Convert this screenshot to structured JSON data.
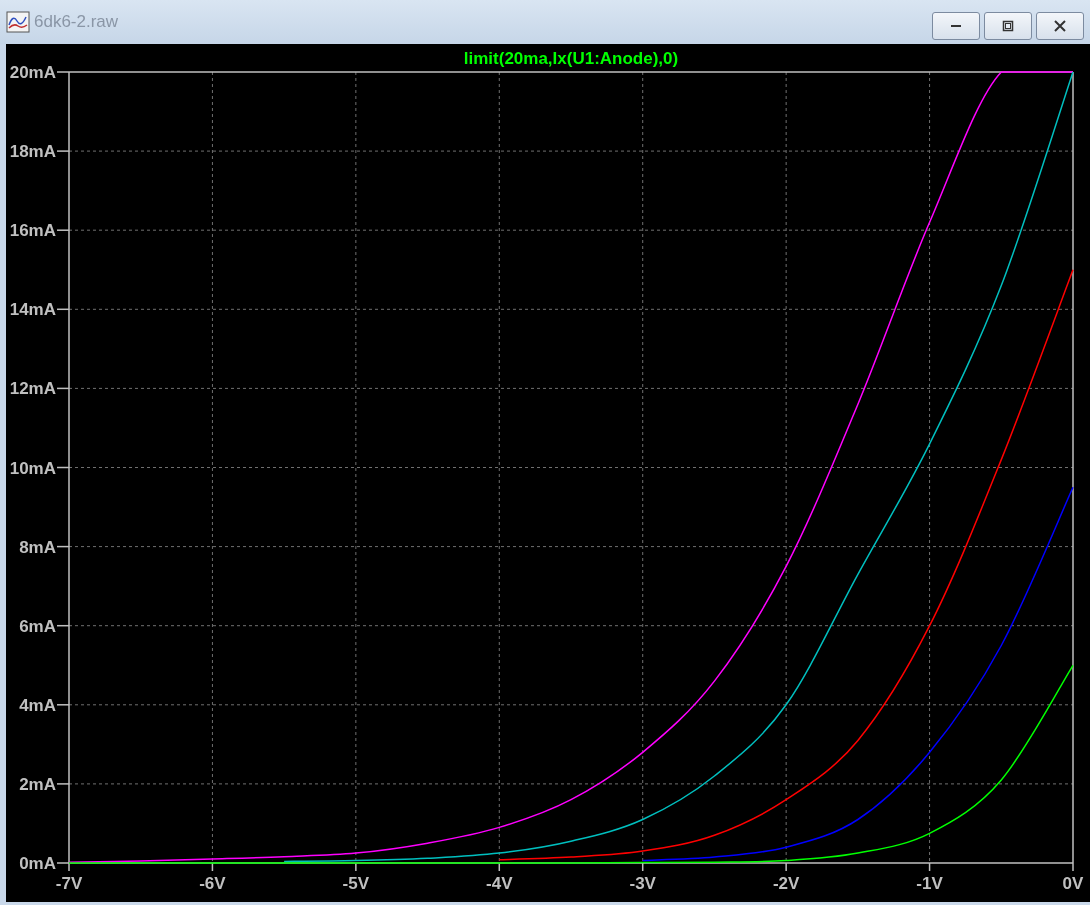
{
  "window": {
    "title": "6dk6-2.raw"
  },
  "plot": {
    "chart_data": {
      "type": "line",
      "title": "limit(20ma,Ix(U1:Anode),0)",
      "x": [
        -7,
        -6.5,
        -6,
        -5.5,
        -5,
        -4.5,
        -4,
        -3.5,
        -3,
        -2.5,
        -2,
        -1.5,
        -1,
        -0.5,
        0
      ],
      "xlim": [
        -7,
        0
      ],
      "ylim": [
        0,
        20
      ],
      "grid": true,
      "xticks": [
        {
          "value": -7,
          "label": "-7V"
        },
        {
          "value": -6,
          "label": "-6V"
        },
        {
          "value": -5,
          "label": "-5V"
        },
        {
          "value": -4,
          "label": "-4V"
        },
        {
          "value": -3,
          "label": "-3V"
        },
        {
          "value": -2,
          "label": "-2V"
        },
        {
          "value": -1,
          "label": "-1V"
        },
        {
          "value": 0,
          "label": "0V"
        }
      ],
      "yticks": [
        {
          "value": 0,
          "label": "0mA"
        },
        {
          "value": 2,
          "label": "2mA"
        },
        {
          "value": 4,
          "label": "4mA"
        },
        {
          "value": 6,
          "label": "6mA"
        },
        {
          "value": 8,
          "label": "8mA"
        },
        {
          "value": 10,
          "label": "10mA"
        },
        {
          "value": 12,
          "label": "12mA"
        },
        {
          "value": 14,
          "label": "14mA"
        },
        {
          "value": 16,
          "label": "16mA"
        },
        {
          "value": 18,
          "label": "18mA"
        },
        {
          "value": 20,
          "label": "20mA"
        }
      ],
      "series": [
        {
          "color": "#ff00ff",
          "values": [
            0.02,
            0.05,
            0.1,
            0.16,
            0.25,
            0.5,
            0.9,
            1.6,
            2.8,
            4.6,
            7.5,
            11.6,
            16.2,
            20,
            20
          ]
        },
        {
          "color": "#00bfbf",
          "values": [
            null,
            null,
            null,
            0.04,
            0.06,
            0.12,
            0.25,
            0.55,
            1.1,
            2.2,
            4.0,
            7.3,
            10.6,
            14.6,
            20
          ]
        },
        {
          "color": "#ff0000",
          "values": [
            null,
            null,
            null,
            null,
            null,
            null,
            0.08,
            0.15,
            0.3,
            0.7,
            1.6,
            3.1,
            6.0,
            10.2,
            15.0
          ]
        },
        {
          "color": "#0000ff",
          "values": [
            null,
            null,
            null,
            null,
            null,
            null,
            null,
            null,
            0.06,
            0.15,
            0.4,
            1.1,
            2.8,
            5.5,
            9.5
          ]
        },
        {
          "color": "#00ff00",
          "values": [
            0,
            0,
            0,
            0,
            0,
            0,
            0,
            0,
            0.01,
            0.02,
            0.06,
            0.25,
            0.75,
            2.1,
            5.0
          ]
        }
      ]
    }
  }
}
